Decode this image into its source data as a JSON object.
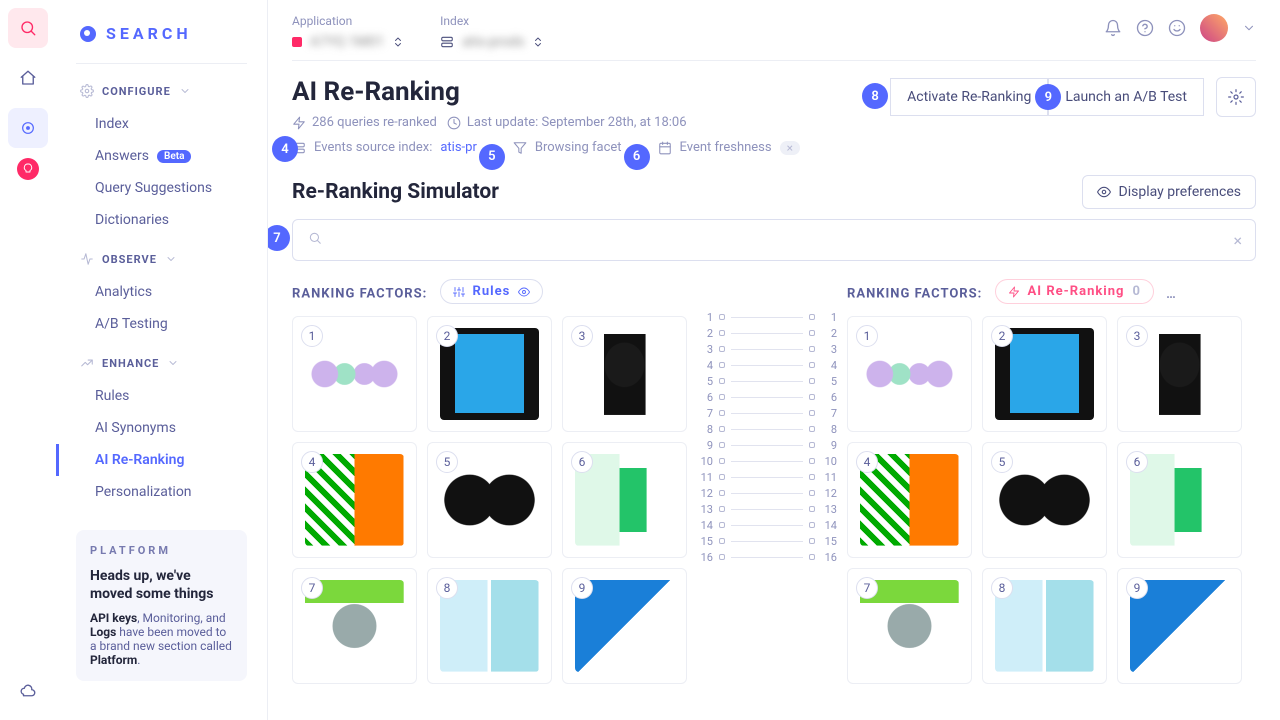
{
  "brand": "SEARCH",
  "topbar": {
    "application_label": "Application",
    "application_value": "A7YQ 1M01",
    "index_label": "Index",
    "index_value": "atis-prods"
  },
  "sections": {
    "configure": {
      "label": "CONFIGURE",
      "items": [
        {
          "label": "Index"
        },
        {
          "label": "Answers",
          "badge": "Beta"
        },
        {
          "label": "Query Suggestions"
        },
        {
          "label": "Dictionaries"
        }
      ]
    },
    "observe": {
      "label": "OBSERVE",
      "items": [
        {
          "label": "Analytics"
        },
        {
          "label": "A/B Testing"
        }
      ]
    },
    "enhance": {
      "label": "ENHANCE",
      "items": [
        {
          "label": "Rules"
        },
        {
          "label": "AI Synonyms"
        },
        {
          "label": "AI Re-Ranking",
          "active": true
        },
        {
          "label": "Personalization"
        }
      ]
    }
  },
  "platform": {
    "tag": "PLATFORM",
    "heading": "Heads up, we've moved some things",
    "body_pre": "API keys",
    "body_mid": ", Monitoring",
    "body_and": ", and ",
    "body_logs": "Logs",
    "body_after": " have been moved to a brand new section called ",
    "body_dest": "Platform",
    "body_end": "."
  },
  "page": {
    "title": "AI Re-Ranking",
    "meta_queries": "286 queries re-ranked",
    "meta_update": "Last update: September 28th, at 18:06",
    "tag_source_label": "Events source index: ",
    "tag_source_value": "atis-pr",
    "tag_facets": "Browsing facet",
    "tag_fresh": "Event freshness",
    "btn_activate": "Activate Re-Ranking",
    "btn_ab": "Launch an A/B Test"
  },
  "simulator": {
    "title": "Re-Ranking Simulator",
    "pref": "Display preferences",
    "factors_label": "RANKING FACTORS:",
    "chip_rules": "Rules",
    "chip_ai": "AI Re-Ranking",
    "chip_ai_count": "0",
    "search_placeholder": ""
  },
  "annotations": {
    "a4": "4",
    "a5": "5",
    "a6": "6",
    "a7": "7",
    "a8": "8",
    "a9": "9"
  },
  "products": [
    "1",
    "2",
    "3",
    "4",
    "5",
    "6",
    "7",
    "8",
    "9"
  ],
  "rungs": [
    "1",
    "2",
    "3",
    "4",
    "5",
    "6",
    "7",
    "8",
    "9",
    "10",
    "11",
    "12",
    "13",
    "14",
    "15",
    "16"
  ]
}
